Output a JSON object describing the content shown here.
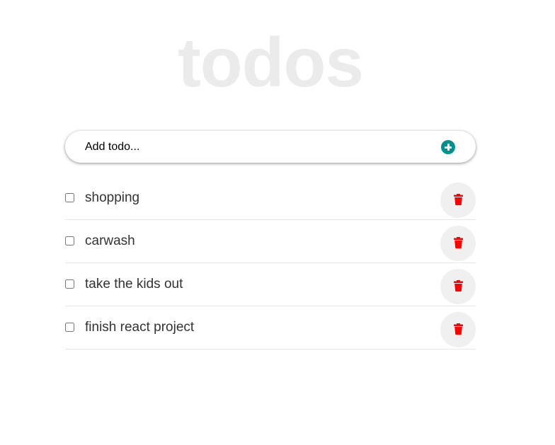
{
  "app": {
    "title": "todos"
  },
  "add_todo": {
    "placeholder": "Add todo...",
    "button_icon": "plus-circle-icon",
    "button_color": "#00918e"
  },
  "todos": [
    {
      "text": "shopping",
      "checked": false
    },
    {
      "text": "carwash",
      "checked": false
    },
    {
      "text": "take the kids out",
      "checked": false
    },
    {
      "text": "finish react project",
      "checked": false
    }
  ],
  "delete_icon": "trash-icon",
  "colors": {
    "title": "#ebebeb",
    "delete_icon": "#ff0000",
    "delete_button_bg": "#f0f0f0",
    "text": "#333333"
  }
}
